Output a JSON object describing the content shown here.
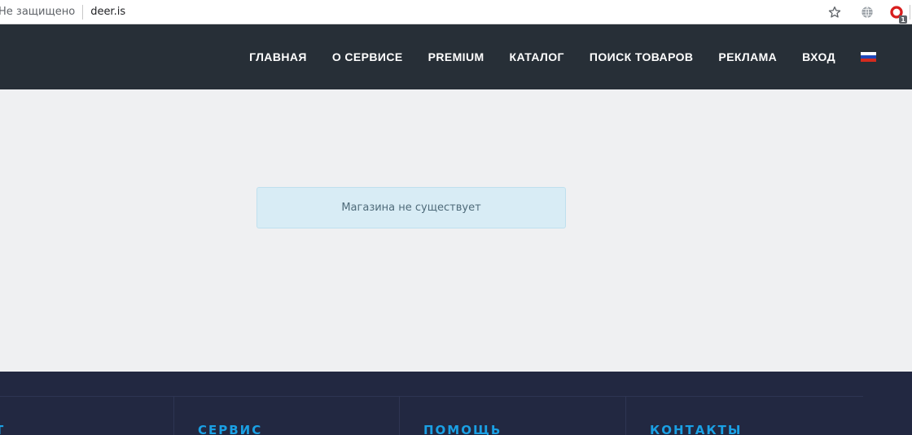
{
  "browser": {
    "security_label": "Не защищено",
    "url": "deer.is",
    "extension_badge": "1",
    "icons": [
      "star-icon",
      "globe-icon",
      "extension-icon"
    ]
  },
  "header": {
    "nav": [
      {
        "id": "home",
        "label": "ГЛАВНАЯ"
      },
      {
        "id": "about",
        "label": "О СЕРВИСЕ"
      },
      {
        "id": "premium",
        "label": "PREMIUM"
      },
      {
        "id": "catalog",
        "label": "КАТАЛОГ"
      },
      {
        "id": "search",
        "label": "ПОИСК ТОВАРОВ"
      },
      {
        "id": "ads",
        "label": "РЕКЛАМА"
      },
      {
        "id": "login",
        "label": "ВХОД"
      }
    ],
    "language_flag": "russian-flag-icon"
  },
  "main": {
    "alert_text": "Магазина не существует"
  },
  "footer": {
    "headings": [
      "Т",
      "СЕРВИС",
      "ПОМОЩЬ",
      "КОНТАКТЫ"
    ]
  },
  "colors": {
    "header_bg": "#272f37",
    "page_bg": "#eff0f2",
    "alert_bg": "#d8ecf5",
    "footer_bg": "#222841",
    "footer_heading": "#1aa0e4"
  }
}
